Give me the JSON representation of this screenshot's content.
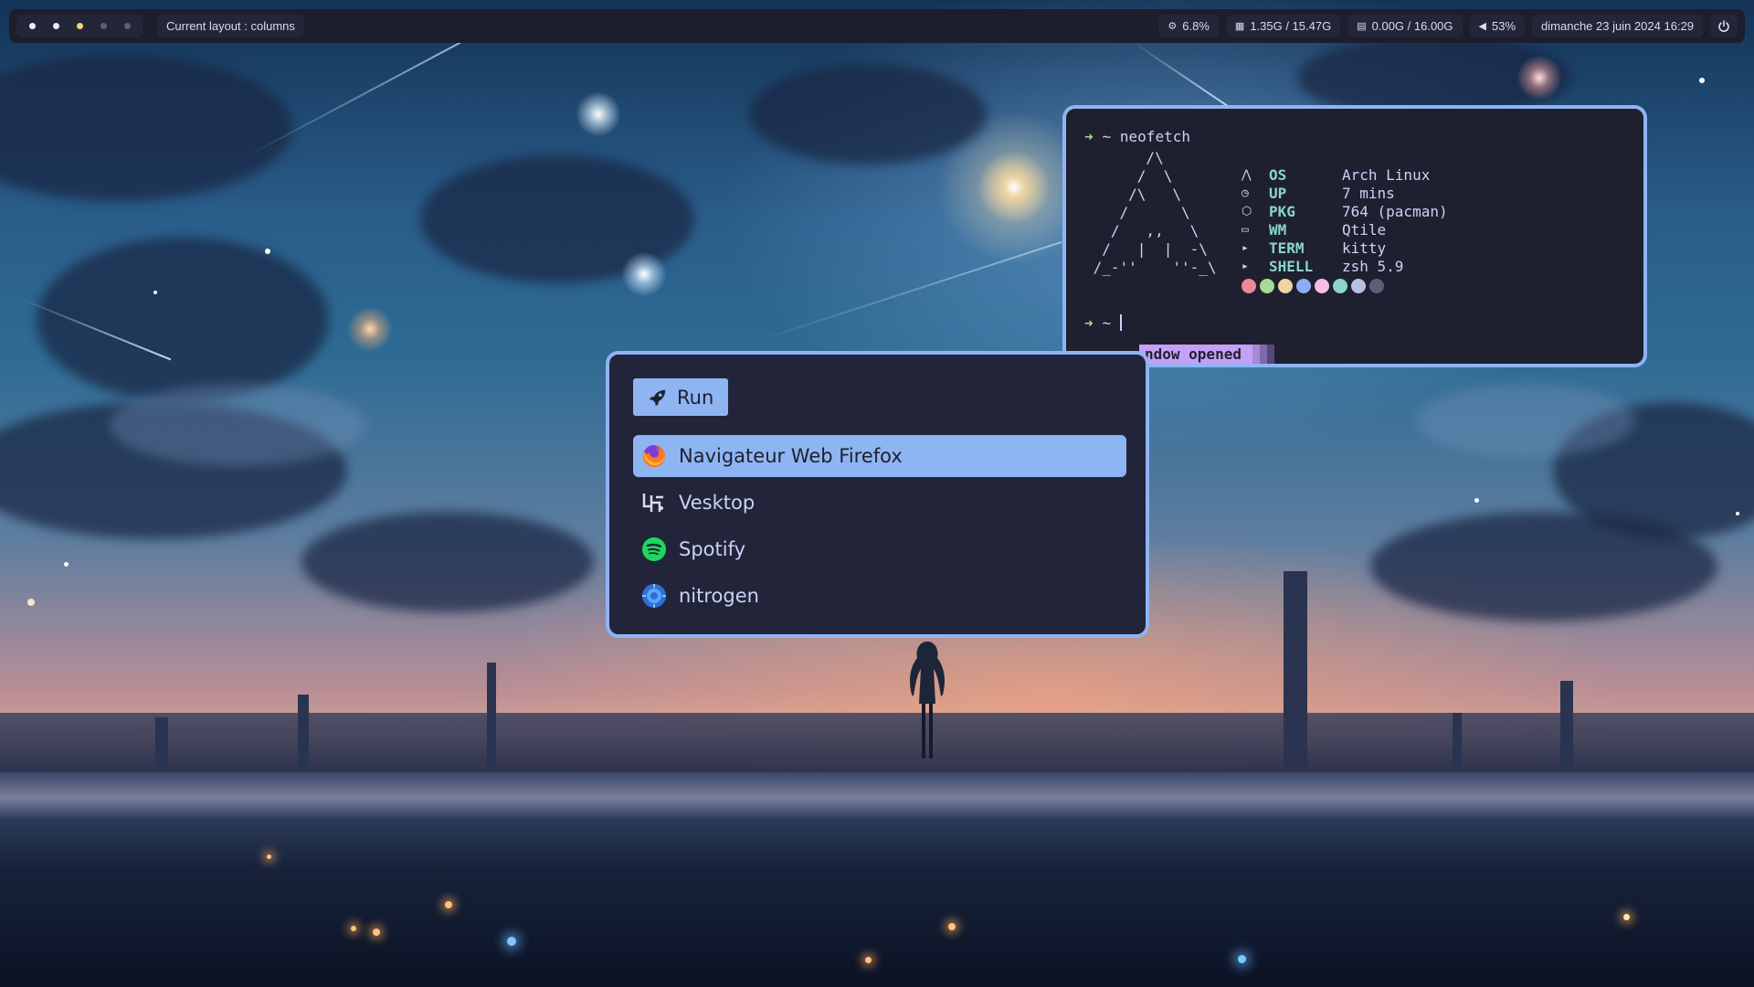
{
  "topbar": {
    "groups": [
      {
        "color": "#e8ecff"
      },
      {
        "color": "#e8ecff"
      },
      {
        "color": "#f5d37a"
      },
      {
        "color": "#5a5f78"
      },
      {
        "color": "#5a5f78"
      }
    ],
    "layout_label": "Current layout : columns",
    "cpu": "6.8%",
    "memory": "1.35G / 15.47G",
    "swap": "0.00G / 16.00G",
    "volume": "53%",
    "datetime": "dimanche 23 juin 2024 16:29"
  },
  "terminal": {
    "prompt_symbol": "➜",
    "command": "~ neofetch",
    "prompt2": "~",
    "ascii_logo": "       /\\\n      /  \\\n     /\\   \\\n    /      \\\n   /   ,,   \\\n  /   |  |  -\\\n /_-''    ''-_\\",
    "info": [
      {
        "icon": "arch-icon",
        "glyph": "⋀",
        "key": "OS",
        "value": "Arch Linux"
      },
      {
        "icon": "clock-icon",
        "glyph": "◷",
        "key": "UP",
        "value": "7 mins"
      },
      {
        "icon": "package-icon",
        "glyph": "⬡",
        "key": "PKG",
        "value": "764 (pacman)"
      },
      {
        "icon": "window-icon",
        "glyph": "▭",
        "key": "WM",
        "value": "Qtile"
      },
      {
        "icon": "terminal-icon",
        "glyph": "▸",
        "key": "TERM",
        "value": "kitty"
      },
      {
        "icon": "shell-icon",
        "glyph": "▸",
        "key": "SHELL",
        "value": "zsh 5.9"
      }
    ],
    "colors": [
      "#ed8796",
      "#a6da95",
      "#eed49f",
      "#8aadf4",
      "#f5bde6",
      "#8bd5ca",
      "#b8c0e0",
      "#5b6078"
    ],
    "notification": "ndow opened"
  },
  "launcher": {
    "mode_label": "Run",
    "items": [
      {
        "label": "Navigateur Web Firefox",
        "icon": "firefox-icon",
        "active": true
      },
      {
        "label": "Vesktop",
        "icon": "vesktop-icon",
        "active": false
      },
      {
        "label": "Spotify",
        "icon": "spotify-icon",
        "active": false
      },
      {
        "label": "nitrogen",
        "icon": "nitrogen-icon",
        "active": false
      }
    ]
  }
}
